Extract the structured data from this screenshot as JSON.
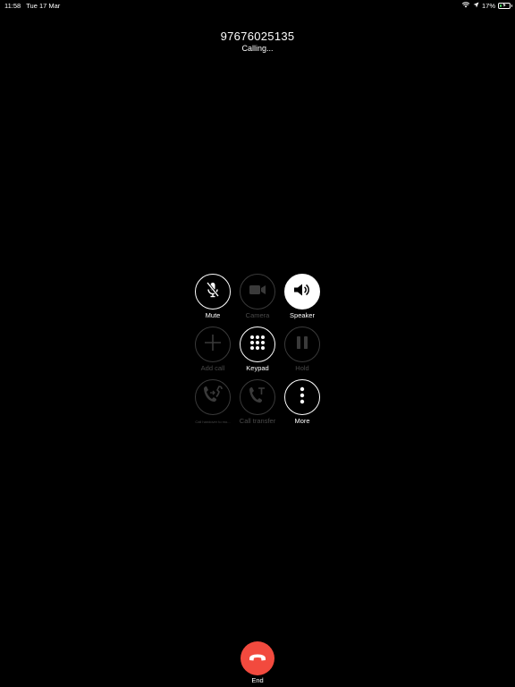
{
  "status_bar": {
    "time": "11:58",
    "date": "Tue 17 Mar",
    "battery_percent_label": "17%",
    "battery_level": 0.17,
    "icons": [
      "wifi-icon",
      "location-arrow-icon",
      "battery-charging-icon"
    ]
  },
  "call": {
    "number": "97676025135",
    "status": "Calling..."
  },
  "controls": [
    {
      "label": "Mute",
      "icon": "mic-off-icon",
      "enabled": true,
      "active": false
    },
    {
      "label": "Camera",
      "icon": "video-camera-icon",
      "enabled": false,
      "active": false
    },
    {
      "label": "Speaker",
      "icon": "speaker-icon",
      "enabled": true,
      "active": true
    },
    {
      "label": "Add call",
      "icon": "plus-icon",
      "enabled": false,
      "active": false
    },
    {
      "label": "Keypad",
      "icon": "keypad-icon",
      "enabled": true,
      "active": false
    },
    {
      "label": "Hold",
      "icon": "pause-icon",
      "enabled": false,
      "active": false
    },
    {
      "label": "Call handover to mo...",
      "icon": "call-handover-icon",
      "enabled": false,
      "active": false
    },
    {
      "label": "Call transfer",
      "icon": "call-transfer-icon",
      "enabled": false,
      "active": false
    },
    {
      "label": "More",
      "icon": "more-vertical-icon",
      "enabled": true,
      "active": false
    }
  ],
  "end_call": {
    "label": "End",
    "icon": "hang-up-icon",
    "color": "#f24a3e"
  },
  "colors": {
    "background": "#000000",
    "enabled": "#ffffff",
    "disabled": "#3a3a3a",
    "charging": "#4cd964"
  }
}
